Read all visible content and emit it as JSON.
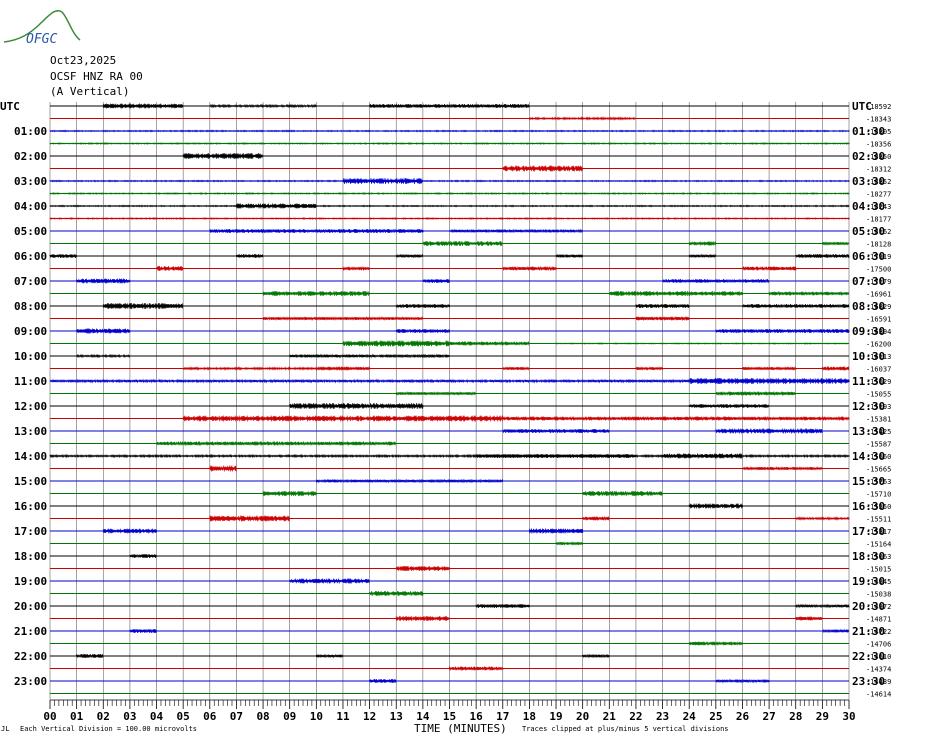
{
  "header": {
    "logo_text": "OFGC",
    "date": "Oct23,2025",
    "station": "OCSF HNZ RA 00",
    "component": "(A Vertical)"
  },
  "axes": {
    "utc_left": "UTC",
    "utc_right": "UTC"
  },
  "footer": {
    "left_mark": "JL",
    "scale_note": "Each Vertical Division = 100.00 microvolts",
    "xlabel": "TIME (MINUTES)",
    "clip_note": "Traces clipped at plus/minus 5 vertical divisions"
  },
  "colors": {
    "trace_cycle": [
      "#000000",
      "#cc0000",
      "#0000cc",
      "#007700"
    ],
    "grid_vertical": "#666666",
    "logo_blue": "#2a5aa8",
    "logo_green": "#3a8a3a"
  },
  "chart_data": {
    "type": "line",
    "title": "",
    "xlabel": "TIME (MINUTES)",
    "ylabel": "",
    "xlim": [
      0,
      30
    ],
    "x_ticks": [
      "00",
      "01",
      "02",
      "03",
      "04",
      "05",
      "06",
      "07",
      "08",
      "09",
      "10",
      "11",
      "12",
      "13",
      "14",
      "15",
      "16",
      "17",
      "18",
      "19",
      "20",
      "21",
      "22",
      "23",
      "24",
      "25",
      "26",
      "27",
      "28",
      "29",
      "30"
    ],
    "left_labels": [
      "UTC",
      "01:00",
      "02:00",
      "03:00",
      "04:00",
      "05:00",
      "06:00",
      "07:00",
      "08:00",
      "09:00",
      "10:00",
      "11:00",
      "12:00",
      "13:00",
      "14:00",
      "15:00",
      "16:00",
      "17:00",
      "18:00",
      "19:00",
      "20:00",
      "21:00",
      "22:00",
      "23:00"
    ],
    "right_labels": [
      "UTC",
      "01:30",
      "02:30",
      "03:30",
      "04:30",
      "05:30",
      "06:30",
      "07:30",
      "08:30",
      "09:30",
      "10:30",
      "11:30",
      "12:30",
      "13:30",
      "14:30",
      "15:30",
      "16:30",
      "17:30",
      "18:30",
      "19:30",
      "20:30",
      "21:30",
      "22:30",
      "23:30"
    ],
    "trace_offsets": [
      -18592,
      -18343,
      -18305,
      -18356,
      -18350,
      -18312,
      -18352,
      -18277,
      -18243,
      -18177,
      -18162,
      -18128,
      -17919,
      -17500,
      -17179,
      -16961,
      -16829,
      -16591,
      -16394,
      -16200,
      -16113,
      -16037,
      -15629,
      -15055,
      -15193,
      -15381,
      -15425,
      -15587,
      -15660,
      -15665,
      -15763,
      -15710,
      -15550,
      -15511,
      -15317,
      -15164,
      -15063,
      -15015,
      -14945,
      -15038,
      -14972,
      -14871,
      -14722,
      -14706,
      -14610,
      -14374,
      -14439,
      -14614
    ],
    "activity": [
      [
        [
          2,
          5,
          2.5
        ],
        [
          12,
          18,
          2
        ],
        [
          6,
          10,
          1
        ]
      ],
      [
        [
          18,
          22,
          1
        ]
      ],
      [
        [
          0,
          30,
          0.6
        ]
      ],
      [
        [
          0,
          30,
          0.6
        ]
      ],
      [
        [
          5,
          8,
          3
        ]
      ],
      [
        [
          17,
          20,
          3
        ]
      ],
      [
        [
          11,
          14,
          3
        ],
        [
          0,
          30,
          0.6
        ]
      ],
      [
        [
          0,
          30,
          0.6
        ]
      ],
      [
        [
          7,
          10,
          2.5
        ],
        [
          0,
          30,
          0.6
        ]
      ],
      [
        [
          0,
          30,
          0.6
        ]
      ],
      [
        [
          6,
          14,
          2
        ],
        [
          15,
          20,
          1.5
        ]
      ],
      [
        [
          14,
          17,
          2.5
        ],
        [
          24,
          25,
          2
        ],
        [
          29,
          30,
          1.5
        ]
      ],
      [
        [
          0,
          1,
          2
        ],
        [
          7,
          8,
          2
        ],
        [
          13,
          14,
          1.5
        ],
        [
          19,
          20,
          1.5
        ],
        [
          24,
          25,
          1.5
        ],
        [
          28,
          30,
          2
        ]
      ],
      [
        [
          4,
          5,
          2.5
        ],
        [
          11,
          12,
          2
        ],
        [
          17,
          19,
          2
        ],
        [
          26,
          28,
          2
        ]
      ],
      [
        [
          1,
          3,
          2.5
        ],
        [
          14,
          15,
          2
        ],
        [
          23,
          27,
          2
        ]
      ],
      [
        [
          8,
          12,
          2.5
        ],
        [
          21,
          26,
          2.5
        ],
        [
          27,
          30,
          2
        ]
      ],
      [
        [
          2,
          5,
          3
        ],
        [
          13,
          15,
          2
        ],
        [
          22,
          24,
          2
        ],
        [
          26,
          30,
          2
        ]
      ],
      [
        [
          8,
          14,
          1.5
        ],
        [
          22,
          24,
          2
        ]
      ],
      [
        [
          1,
          3,
          2.5
        ],
        [
          13,
          15,
          2
        ],
        [
          25,
          30,
          2
        ]
      ],
      [
        [
          11,
          15,
          3
        ],
        [
          15,
          18,
          2
        ],
        [
          19,
          30,
          0.5
        ]
      ],
      [
        [
          1,
          3,
          1
        ],
        [
          9,
          15,
          1.5
        ]
      ],
      [
        [
          5,
          10,
          1
        ],
        [
          10,
          12,
          2
        ],
        [
          17,
          18,
          1.5
        ],
        [
          22,
          23,
          1.5
        ],
        [
          26,
          28,
          1.5
        ],
        [
          29,
          30,
          2
        ]
      ],
      [
        [
          0,
          30,
          1.2
        ],
        [
          24,
          30,
          3
        ]
      ],
      [
        [
          13,
          16,
          1.5
        ],
        [
          25,
          28,
          2
        ]
      ],
      [
        [
          9,
          14,
          3
        ],
        [
          24,
          27,
          2
        ]
      ],
      [
        [
          5,
          17,
          3
        ],
        [
          17,
          30,
          2
        ]
      ],
      [
        [
          17,
          21,
          2
        ],
        [
          25,
          29,
          2.5
        ]
      ],
      [
        [
          4,
          13,
          2
        ]
      ],
      [
        [
          0,
          30,
          1
        ],
        [
          16,
          22,
          2
        ],
        [
          23,
          26,
          2.5
        ]
      ],
      [
        [
          6,
          7,
          3
        ],
        [
          26,
          29,
          1.5
        ]
      ],
      [
        [
          10,
          17,
          1.5
        ]
      ],
      [
        [
          8,
          10,
          2.5
        ],
        [
          20,
          23,
          2.5
        ]
      ],
      [
        [
          24,
          26,
          2.5
        ]
      ],
      [
        [
          6,
          9,
          3
        ],
        [
          20,
          21,
          2
        ],
        [
          28,
          30,
          1
        ]
      ],
      [
        [
          2,
          4,
          2.5
        ],
        [
          18,
          20,
          2.5
        ]
      ],
      [
        [
          19,
          20,
          1.5
        ]
      ],
      [
        [
          3,
          4,
          2
        ]
      ],
      [
        [
          13,
          15,
          2.5
        ]
      ],
      [
        [
          9,
          12,
          2.5
        ]
      ],
      [
        [
          12,
          14,
          2.5
        ]
      ],
      [
        [
          16,
          18,
          2
        ],
        [
          28,
          30,
          1.5
        ]
      ],
      [
        [
          13,
          15,
          2.5
        ],
        [
          28,
          29,
          2
        ]
      ],
      [
        [
          3,
          4,
          2
        ],
        [
          29,
          30,
          1.5
        ]
      ],
      [
        [
          24,
          26,
          2
        ]
      ],
      [
        [
          1,
          2,
          2
        ],
        [
          10,
          11,
          1.5
        ],
        [
          20,
          21,
          1.5
        ]
      ],
      [
        [
          15,
          17,
          2
        ]
      ],
      [
        [
          12,
          13,
          2
        ],
        [
          25,
          27,
          1.5
        ]
      ],
      []
    ]
  }
}
